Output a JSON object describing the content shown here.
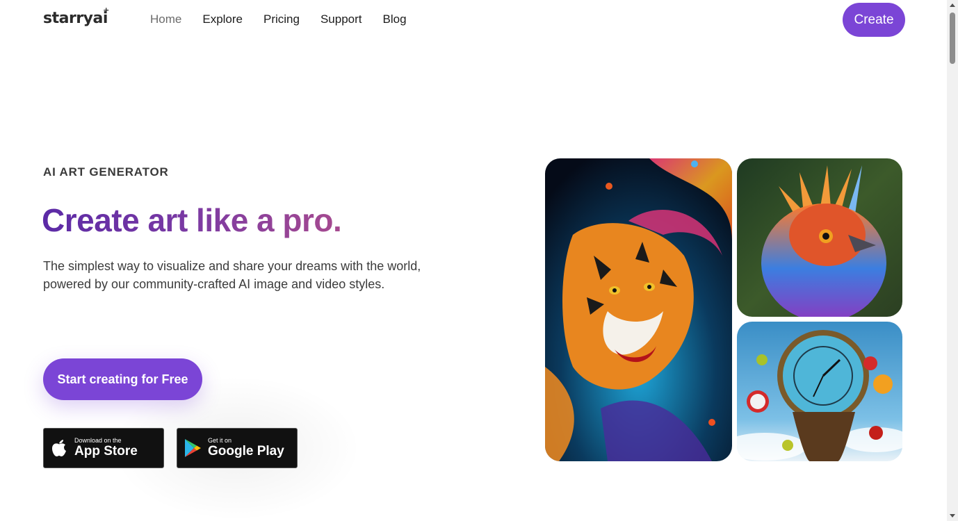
{
  "brand": {
    "name": "starryai",
    "spark": "+"
  },
  "nav": {
    "links": [
      {
        "label": "Home",
        "active": true
      },
      {
        "label": "Explore",
        "active": false
      },
      {
        "label": "Pricing",
        "active": false
      },
      {
        "label": "Support",
        "active": false
      },
      {
        "label": "Blog",
        "active": false
      }
    ],
    "create_label": "Create"
  },
  "hero": {
    "eyebrow": "AI ART GENERATOR",
    "headline": "Create art like a pro.",
    "subtext": "The simplest way to visualize and share your dreams with the world, powered by our community-crafted AI image and video styles.",
    "cta_label": "Start creating for Free",
    "app_store": {
      "small": "Download on the",
      "big": "App Store"
    },
    "google_play": {
      "small": "Get it on",
      "big": "Google Play"
    }
  },
  "gallery": [
    {
      "subject": "colorful tiger splash art"
    },
    {
      "subject": "colorful feathered bird"
    },
    {
      "subject": "surreal melting clock with apples"
    }
  ],
  "colors": {
    "accent": "#7b45d6",
    "headline_gradient_start": "#5b2aa6",
    "headline_gradient_end": "#a64a8f"
  }
}
